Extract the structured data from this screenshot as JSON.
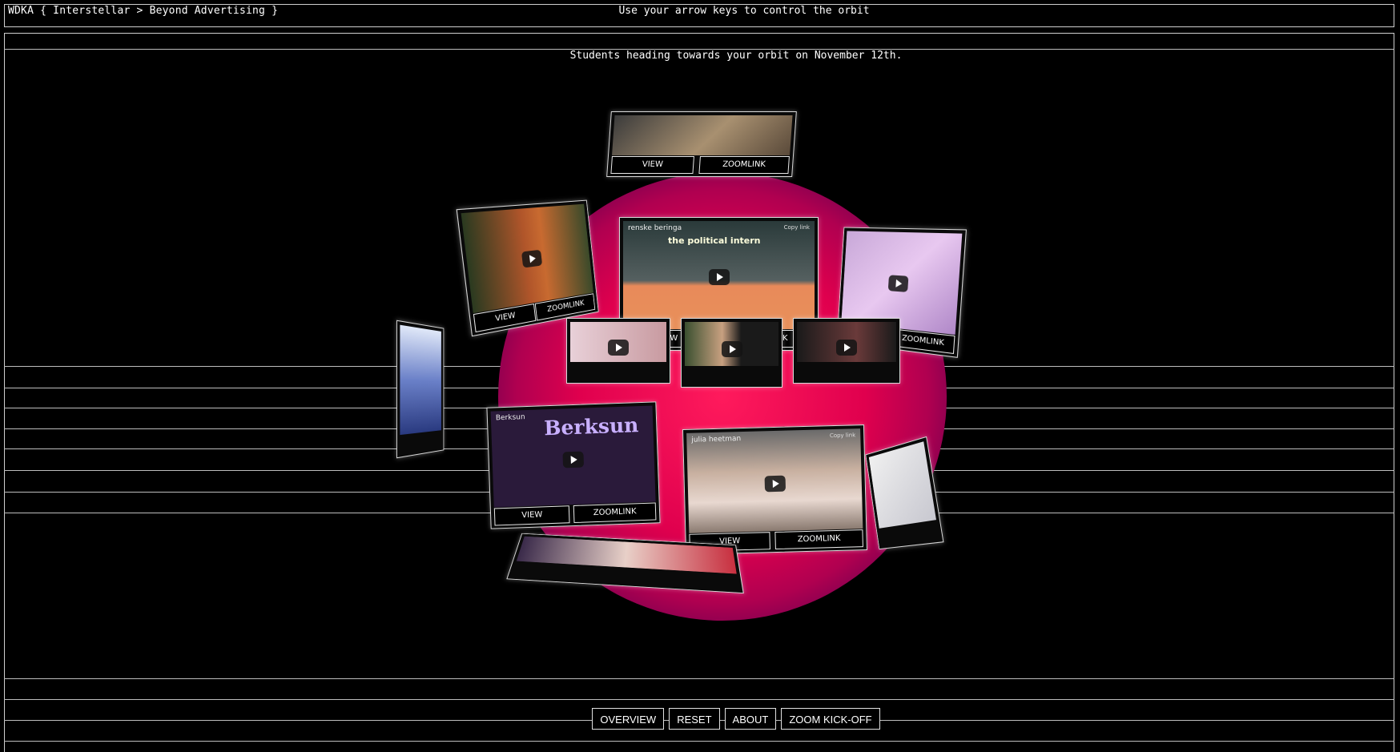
{
  "header": {
    "brand": "WDKA { Interstellar > Beyond Advertising }",
    "hint": "Use your arrow keys to control the orbit"
  },
  "subtitle": "Students heading towards your orbit on November 12th.",
  "cards": {
    "view_label": "VIEW",
    "zoom_label": "ZOOMLINK",
    "main_title": "renske beringa",
    "main_headline": "the political intern",
    "julia_title": "julia heetman",
    "berksun_title": "Berksun",
    "berksun_text": "Berksun",
    "copy_link": "Copy link"
  },
  "nav": {
    "overview": "OVERVIEW",
    "reset": "RESET",
    "about": "ABOUT",
    "zoom_kickoff": "ZOOM KICK-OFF"
  },
  "colors": {
    "background": "#000000",
    "sphere": "#e0004e",
    "border": "#cfcfcf"
  }
}
